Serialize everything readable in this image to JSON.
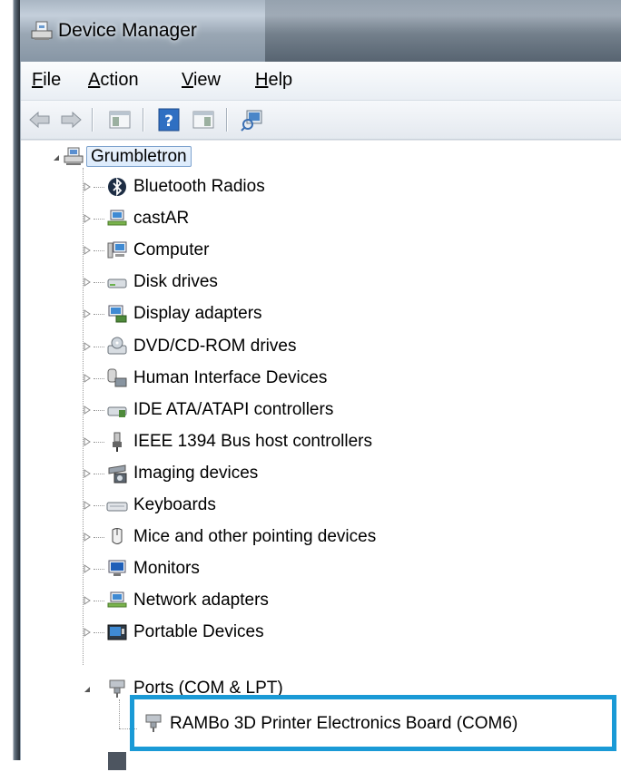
{
  "window": {
    "title": "Device Manager"
  },
  "menu": {
    "items": [
      {
        "label": "File",
        "accel": "F",
        "rest": "ile"
      },
      {
        "label": "Action",
        "accel": "A",
        "rest": "ction"
      },
      {
        "label": "View",
        "accel": "V",
        "rest": "iew"
      },
      {
        "label": "Help",
        "accel": "H",
        "rest": "elp"
      }
    ]
  },
  "toolbar": {
    "buttons": [
      "back-icon",
      "forward-icon",
      "show-hide-console-tree-icon",
      "help-icon",
      "show-hide-action-pane-icon",
      "scan-hardware-changes-icon"
    ]
  },
  "tree": {
    "root": "Grumbletron",
    "categories": [
      {
        "label": "Bluetooth Radios",
        "icon": "bluetooth-icon"
      },
      {
        "label": "castAR",
        "icon": "network-device-icon"
      },
      {
        "label": "Computer",
        "icon": "computer-icon"
      },
      {
        "label": "Disk drives",
        "icon": "disk-drive-icon"
      },
      {
        "label": "Display adapters",
        "icon": "display-adapter-icon"
      },
      {
        "label": "DVD/CD-ROM drives",
        "icon": "dvd-drive-icon"
      },
      {
        "label": "Human Interface Devices",
        "icon": "hid-icon"
      },
      {
        "label": "IDE ATA/ATAPI controllers",
        "icon": "ide-controller-icon"
      },
      {
        "label": "IEEE 1394 Bus host controllers",
        "icon": "firewire-icon"
      },
      {
        "label": "Imaging devices",
        "icon": "camera-icon"
      },
      {
        "label": "Keyboards",
        "icon": "keyboard-icon"
      },
      {
        "label": "Mice and other pointing devices",
        "icon": "mouse-icon"
      },
      {
        "label": "Monitors",
        "icon": "monitor-icon"
      },
      {
        "label": "Network adapters",
        "icon": "network-adapter-icon"
      },
      {
        "label": "Portable Devices",
        "icon": "portable-device-icon"
      }
    ],
    "ports": {
      "label": "Ports (COM & LPT)",
      "child": "RAMBo 3D Printer Electronics Board (COM6)"
    }
  },
  "colors": {
    "highlight_border": "#1a9ad6",
    "selection_border": "#7da2ce"
  }
}
